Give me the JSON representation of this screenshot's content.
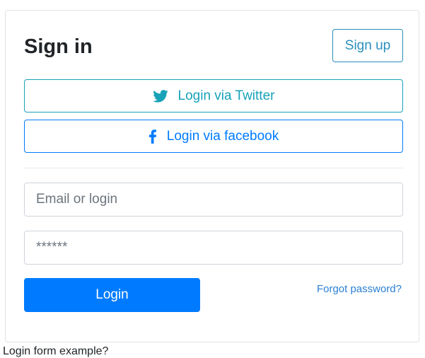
{
  "card": {
    "title": "Sign in",
    "signup_label": "Sign up",
    "social": {
      "twitter_label": "Login via Twitter",
      "twitter_icon": "twitter-icon",
      "facebook_label": "Login via facebook",
      "facebook_icon": "facebook-icon"
    },
    "form": {
      "email_placeholder": "Email or login",
      "password_placeholder": "******",
      "login_label": "Login",
      "forgot_label": "Forgot password?"
    }
  },
  "footer": {
    "text": "Login form example?"
  },
  "colors": {
    "primary": "#007bff",
    "twitter": "#17a2b8",
    "signup": "#2a8fbd"
  }
}
